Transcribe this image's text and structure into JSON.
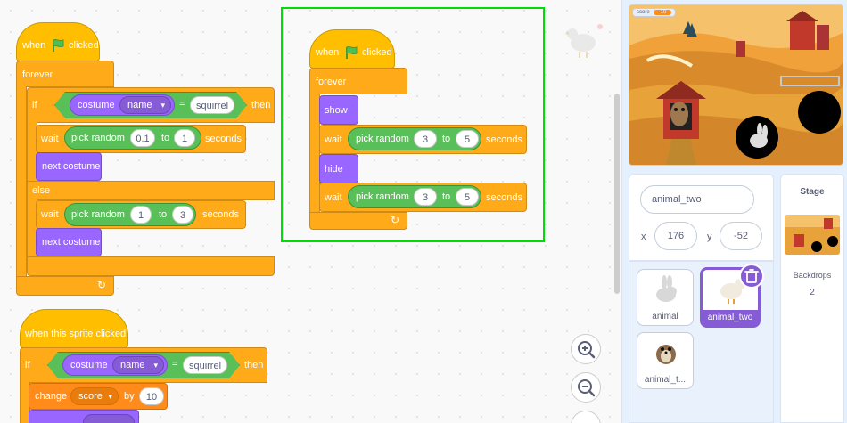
{
  "code": {
    "script1": {
      "hat": {
        "word": "when",
        "suffix": "clicked"
      },
      "forever": "forever",
      "if": "if",
      "then": "then",
      "costume_reporter": "costume",
      "costume_menu": "name",
      "equals": "=",
      "compare_value": "squirrel",
      "wait1": {
        "wait": "wait",
        "op": "pick random",
        "from": "0.1",
        "to_word": "to",
        "to": "1",
        "unit": "seconds"
      },
      "next1": "next costume",
      "else": "else",
      "wait2": {
        "wait": "wait",
        "op": "pick random",
        "from": "1",
        "to_word": "to",
        "to": "3",
        "unit": "seconds"
      },
      "next2": "next costume"
    },
    "script2": {
      "hat": {
        "word": "when",
        "suffix": "clicked"
      },
      "forever": "forever",
      "show": "show",
      "wait1": {
        "wait": "wait",
        "op": "pick random",
        "from": "3",
        "to_word": "to",
        "to": "5",
        "unit": "seconds"
      },
      "hide": "hide",
      "wait2": {
        "wait": "wait",
        "op": "pick random",
        "from": "3",
        "to_word": "to",
        "to": "5",
        "unit": "seconds"
      }
    },
    "script3": {
      "hat": "when this sprite clicked",
      "if": "if",
      "then": "then",
      "costume_reporter": "costume",
      "costume_menu": "name",
      "equals": "=",
      "compare_value": "squirrel",
      "change": "change",
      "var_menu": "score",
      "by": "by",
      "amount": "10"
    }
  },
  "stage": {
    "monitor_label": "score",
    "monitor_value": "-10"
  },
  "sprite_info": {
    "name": "animal_two",
    "x_label": "x",
    "x_value": "176",
    "y_label": "y",
    "y_value": "-52"
  },
  "sprites": [
    {
      "label": "animal"
    },
    {
      "label": "animal_two"
    },
    {
      "label": "animal_t..."
    }
  ],
  "stage_pane": {
    "title": "Stage",
    "backdrops_label": "Backdrops",
    "backdrops_count": "2"
  },
  "colors": {
    "events": "#ffbf00",
    "control": "#ffab19",
    "looks": "#9966ff",
    "operators": "#59c059",
    "variables": "#ff8c1a",
    "highlight": "#00dd00"
  }
}
